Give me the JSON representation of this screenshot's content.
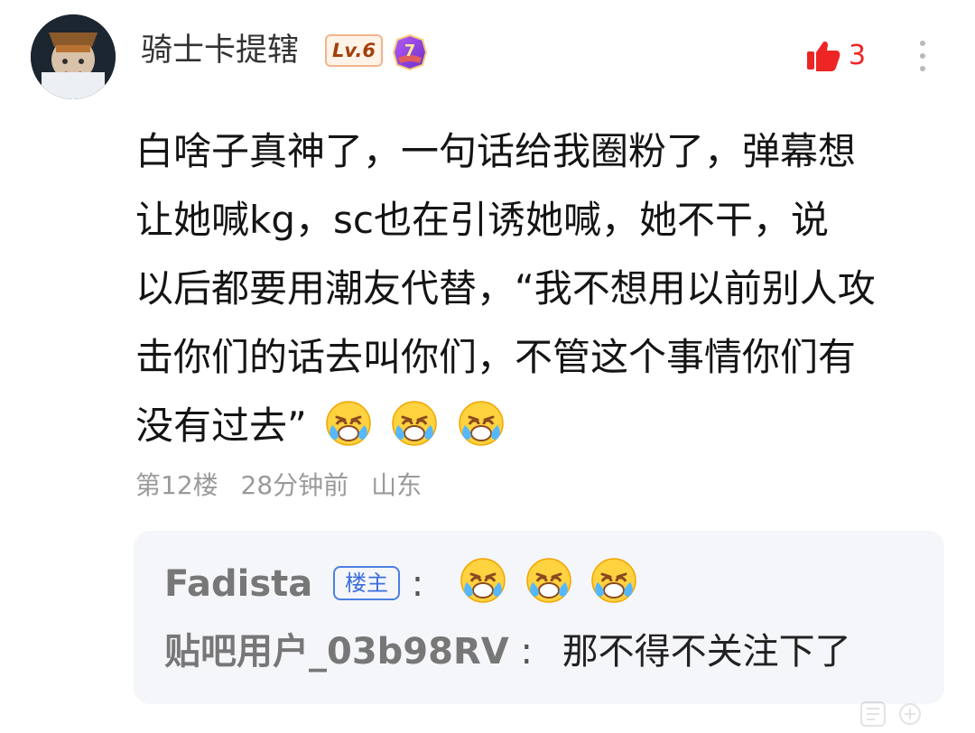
{
  "comment": {
    "author": {
      "name": "骑士卡提辖",
      "level": "Lv.6",
      "membership_badge": "7"
    },
    "likes": "3",
    "content_lines": [
      "白啥子真神了，一句话给我圈粉了，弹幕想",
      "让她喊kg，sc也在引诱她喊，她不干，说",
      "以后都要用潮友代替，“我不想用以前别人攻",
      "击你们的话去叫你们，不管这个事情你们有",
      "没有过去”"
    ],
    "content_emojis": [
      "crying-emoji",
      "crying-emoji",
      "crying-emoji"
    ],
    "meta": {
      "floor": "第12楼",
      "time": "28分钟前",
      "location": "山东"
    }
  },
  "replies": [
    {
      "author": "Fadista",
      "badge": "楼主",
      "separator": ":",
      "emojis": [
        "crying-emoji",
        "crying-emoji",
        "crying-emoji"
      ]
    },
    {
      "author": "贴吧用户_03b98RV",
      "separator": ":",
      "text": "那不得不关注下了"
    }
  ],
  "colors": {
    "accent_red": "#ee2525",
    "owner_badge_blue": "#3c6edc",
    "level_badge_orange": "#a1410b",
    "meta_gray": "#9a9a9a",
    "reply_bg": "#f5f6fa"
  }
}
